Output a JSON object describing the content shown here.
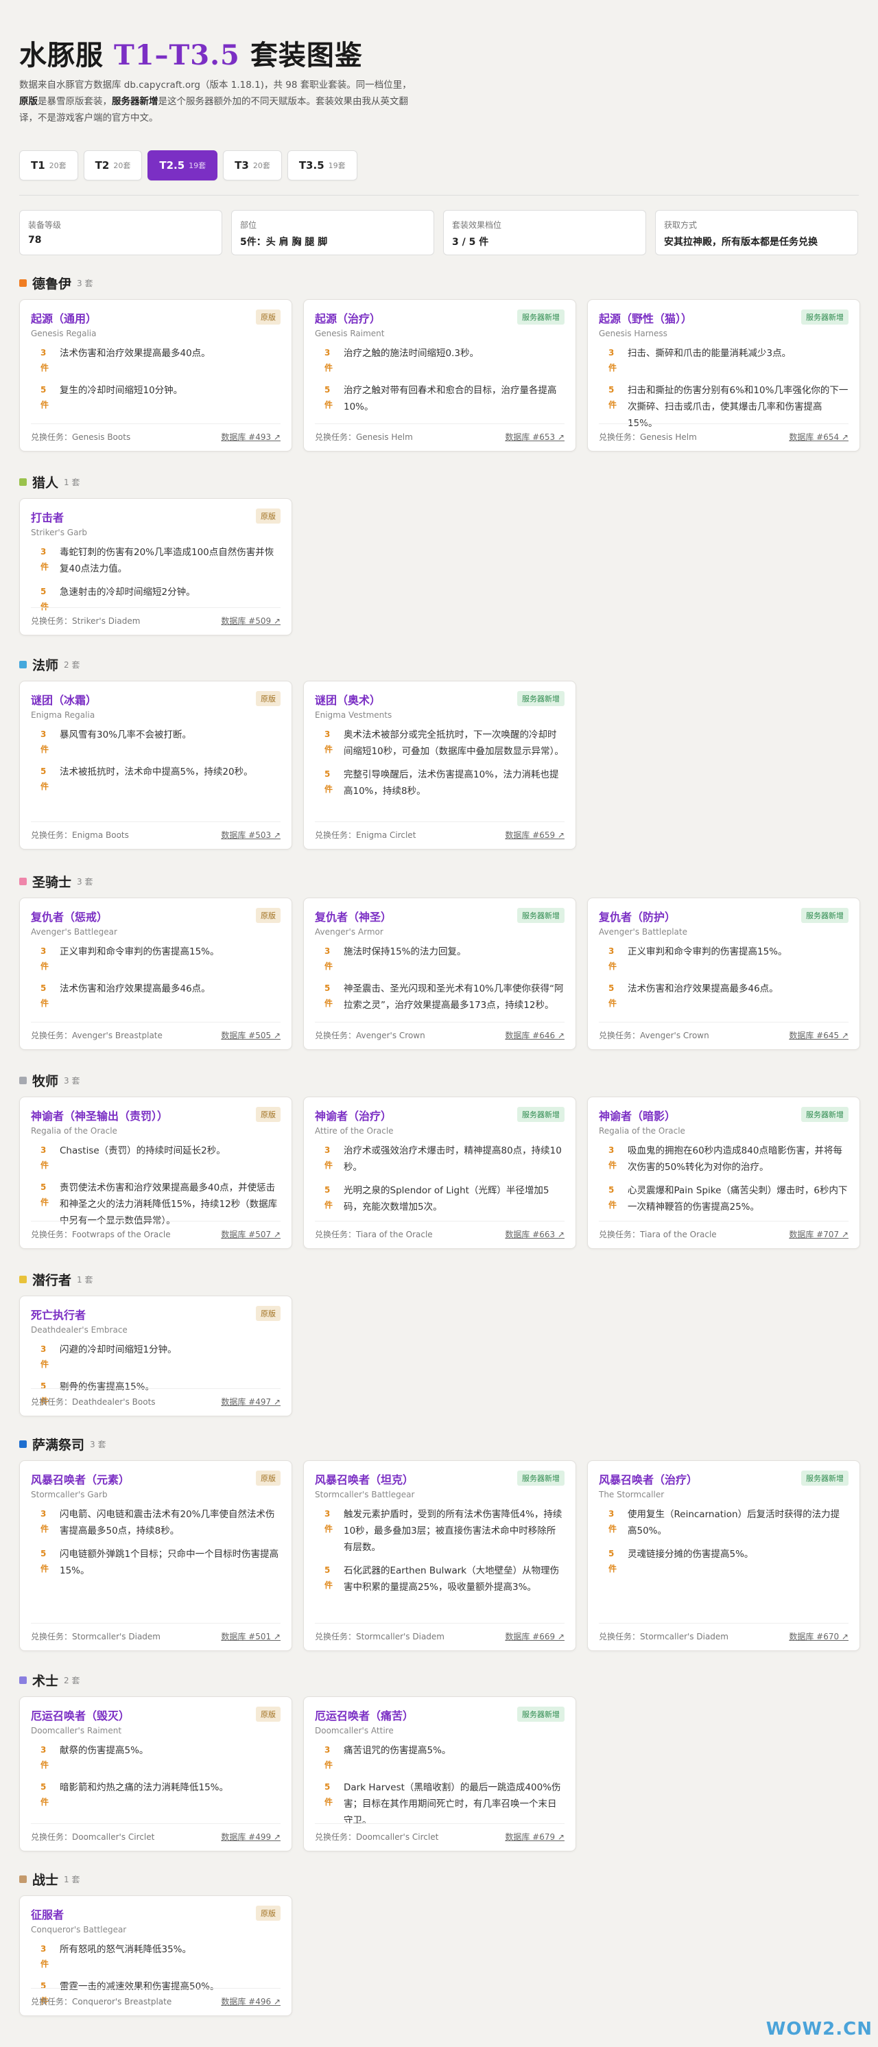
{
  "header": {
    "title_a": "水豚服 ",
    "title_b": "T1–T3.5",
    "title_c": " 套装图鉴",
    "intro_1": "数据来自水豚官方数据库 db.capycraft.org（版本 1.18.1)，共 98 套职业套装。同一档位里，",
    "intro_bold_1": "原版",
    "intro_2": "是暴雪原版套装，",
    "intro_bold_2": "服务器新增",
    "intro_3": "是这个服务器额外加的不同天赋版本。套装效果由我从英文翻译，不是游戏客户端的官方中文。"
  },
  "tabs": [
    {
      "label": "T1",
      "count": "20套"
    },
    {
      "label": "T2",
      "count": "20套"
    },
    {
      "label": "T2.5",
      "count": "19套"
    },
    {
      "label": "T3",
      "count": "20套"
    },
    {
      "label": "T3.5",
      "count": "19套"
    }
  ],
  "filters": [
    {
      "label": "装备等级",
      "value": "78"
    },
    {
      "label": "部位",
      "value": "5件：头 肩 胸 腿 脚"
    },
    {
      "label": "套装效果档位",
      "value": "3 / 5 件"
    },
    {
      "label": "获取方式",
      "value": "安其拉神殿，所有版本都是任务兑换"
    }
  ],
  "sections": [
    {
      "name": "德鲁伊",
      "count": "3 套",
      "color": "#f07d22",
      "cards": [
        {
          "name": "起源（通用）",
          "sub": "Genesis Regalia",
          "badge": "原版",
          "b3": "法术伤害和治疗效果提高最多40点。",
          "b5": "复生的冷却时间缩短10分钟。",
          "quest": "兑换任务：Genesis Boots",
          "link": "数据库 #493 ↗"
        },
        {
          "name": "起源（治疗）",
          "sub": "Genesis Raiment",
          "badge": "服务器新增",
          "b3": "治疗之触的施法时间缩短0.3秒。",
          "b5": "治疗之触对带有回春术和愈合的目标，治疗量各提高10%。",
          "quest": "兑换任务：Genesis Helm",
          "link": "数据库 #653 ↗"
        },
        {
          "name": "起源（野性（猫））",
          "sub": "Genesis Harness",
          "badge": "服务器新增",
          "b3": "扫击、撕碎和爪击的能量消耗减少3点。",
          "b5": "扫击和撕扯的伤害分别有6%和10%几率强化你的下一次撕碎、扫击或爪击，使其爆击几率和伤害提高15%。",
          "quest": "兑换任务：Genesis Helm",
          "link": "数据库 #654 ↗"
        }
      ]
    },
    {
      "name": "猎人",
      "count": "1 套",
      "color": "#9ac24c",
      "cards": [
        {
          "name": "打击者",
          "sub": "Striker's Garb",
          "badge": "原版",
          "b3": "毒蛇钉刺的伤害有20%几率造成100点自然伤害并恢复40点法力值。",
          "b5": "急速射击的冷却时间缩短2分钟。",
          "quest": "兑换任务：Striker's Diadem",
          "link": "数据库 #509 ↗"
        }
      ]
    },
    {
      "name": "法师",
      "count": "2 套",
      "color": "#45a8dc",
      "cards": [
        {
          "name": "谜团（冰霜）",
          "sub": "Enigma Regalia",
          "badge": "原版",
          "b3": "暴风雪有30%几率不会被打断。",
          "b5": "法术被抵抗时，法术命中提高5%，持续20秒。",
          "quest": "兑换任务：Enigma Boots",
          "link": "数据库 #503 ↗"
        },
        {
          "name": "谜团（奥术）",
          "sub": "Enigma Vestments",
          "badge": "服务器新增",
          "b3": "奥术法术被部分或完全抵抗时，下一次唤醒的冷却时间缩短10秒，可叠加（数据库中叠加层数显示异常）。",
          "b5": "完整引导唤醒后，法术伤害提高10%，法力消耗也提高10%，持续8秒。",
          "quest": "兑换任务：Enigma Circlet",
          "link": "数据库 #659 ↗"
        }
      ]
    },
    {
      "name": "圣骑士",
      "count": "3 套",
      "color": "#ef86aa",
      "cards": [
        {
          "name": "复仇者（惩戒）",
          "sub": "Avenger's Battlegear",
          "badge": "原版",
          "b3": "正义审判和命令审判的伤害提高15%。",
          "b5": "法术伤害和治疗效果提高最多46点。",
          "quest": "兑换任务：Avenger's Breastplate",
          "link": "数据库 #505 ↗"
        },
        {
          "name": "复仇者（神圣）",
          "sub": "Avenger's Armor",
          "badge": "服务器新增",
          "b3": "施法时保持15%的法力回复。",
          "b5": "神圣震击、圣光闪现和圣光术有10%几率使你获得“阿拉索之灵”，治疗效果提高最多173点，持续12秒。",
          "quest": "兑换任务：Avenger's Crown",
          "link": "数据库 #646 ↗"
        },
        {
          "name": "复仇者（防护）",
          "sub": "Avenger's Battleplate",
          "badge": "服务器新增",
          "b3": "正义审判和命令审判的伤害提高15%。",
          "b5": "法术伤害和治疗效果提高最多46点。",
          "quest": "兑换任务：Avenger's Crown",
          "link": "数据库 #645 ↗"
        }
      ]
    },
    {
      "name": "牧师",
      "count": "3 套",
      "color": "#a6a9b0",
      "cards": [
        {
          "name": "神谕者（神圣输出（责罚））",
          "sub": "Regalia of the Oracle",
          "badge": "原版",
          "b3": "Chastise（责罚）的持续时间延长2秒。",
          "b5": "责罚使法术伤害和治疗效果提高最多40点，并使惩击和神圣之火的法力消耗降低15%，持续12秒（数据库中另有一个显示数值异常）。",
          "quest": "兑换任务：Footwraps of the Oracle",
          "link": "数据库 #507 ↗"
        },
        {
          "name": "神谕者（治疗）",
          "sub": "Attire of the Oracle",
          "badge": "服务器新增",
          "b3": "治疗术或强效治疗术爆击时，精神提高80点，持续10秒。",
          "b5": "光明之泉的Splendor of Light（光辉）半径增加5码，充能次数增加5次。",
          "quest": "兑换任务：Tiara of the Oracle",
          "link": "数据库 #663 ↗"
        },
        {
          "name": "神谕者（暗影）",
          "sub": "Regalia of the Oracle",
          "badge": "服务器新增",
          "b3": "吸血鬼的拥抱在60秒内造成840点暗影伤害，并将每次伤害的50%转化为对你的治疗。",
          "b5": "心灵震爆和Pain Spike（痛苦尖刺）爆击时，6秒内下一次精神鞭笞的伤害提高25%。",
          "quest": "兑换任务：Tiara of the Oracle",
          "link": "数据库 #707 ↗"
        }
      ]
    },
    {
      "name": "潜行者",
      "count": "1 套",
      "color": "#e8c23a",
      "cards": [
        {
          "name": "死亡执行者",
          "sub": "Deathdealer's Embrace",
          "badge": "原版",
          "b3": "闪避的冷却时间缩短1分钟。",
          "b5": "剔骨的伤害提高15%。",
          "quest": "兑换任务：Deathdealer's Boots",
          "link": "数据库 #497 ↗"
        }
      ]
    },
    {
      "name": "萨满祭司",
      "count": "3 套",
      "color": "#1f6fcf",
      "cards": [
        {
          "name": "风暴召唤者（元素）",
          "sub": "Stormcaller's Garb",
          "badge": "原版",
          "b3": "闪电箭、闪电链和震击法术有20%几率使自然法术伤害提高最多50点，持续8秒。",
          "b5": "闪电链额外弹跳1个目标；只命中一个目标时伤害提高15%。",
          "quest": "兑换任务：Stormcaller's Diadem",
          "link": "数据库 #501 ↗"
        },
        {
          "name": "风暴召唤者（坦克）",
          "sub": "Stormcaller's Battlegear",
          "badge": "服务器新增",
          "b3": "触发元素护盾时，受到的所有法术伤害降低4%，持续10秒，最多叠加3层；被直接伤害法术命中时移除所有层数。",
          "b5": "石化武器的Earthen Bulwark（大地壁垒）从物理伤害中积累的量提高25%，吸收量额外提高3%。",
          "quest": "兑换任务：Stormcaller's Diadem",
          "link": "数据库 #669 ↗"
        },
        {
          "name": "风暴召唤者（治疗）",
          "sub": "The Stormcaller",
          "badge": "服务器新增",
          "b3": "使用复生（Reincarnation）后复活时获得的法力提高50%。",
          "b5": "灵魂链接分摊的伤害提高5%。",
          "quest": "兑换任务：Stormcaller's Diadem",
          "link": "数据库 #670 ↗"
        }
      ]
    },
    {
      "name": "术士",
      "count": "2 套",
      "color": "#8a7fe0",
      "cards": [
        {
          "name": "厄运召唤者（毁灭）",
          "sub": "Doomcaller's Raiment",
          "badge": "原版",
          "b3": "献祭的伤害提高5%。",
          "b5": "暗影箭和灼热之痛的法力消耗降低15%。",
          "quest": "兑换任务：Doomcaller's Circlet",
          "link": "数据库 #499 ↗"
        },
        {
          "name": "厄运召唤者（痛苦）",
          "sub": "Doomcaller's Attire",
          "badge": "服务器新增",
          "b3": "痛苦诅咒的伤害提高5%。",
          "b5": "Dark Harvest（黑暗收割）的最后一跳造成400%伤害；目标在其作用期间死亡时，有几率召唤一个末日守卫。",
          "quest": "兑换任务：Doomcaller's Circlet",
          "link": "数据库 #679 ↗"
        }
      ]
    },
    {
      "name": "战士",
      "count": "1 套",
      "color": "#c49a6c",
      "cards": [
        {
          "name": "征服者",
          "sub": "Conqueror's Battlegear",
          "badge": "原版",
          "b3": "所有怒吼的怒气消耗降低35%。",
          "b5": "雷霆一击的减速效果和伤害提高50%。",
          "quest": "兑换任务：Conqueror's Breastplate",
          "link": "数据库 #496 ↗"
        }
      ]
    }
  ],
  "labels": {
    "p3": "3件",
    "p5": "5件"
  },
  "watermark": "WOW2.CN"
}
